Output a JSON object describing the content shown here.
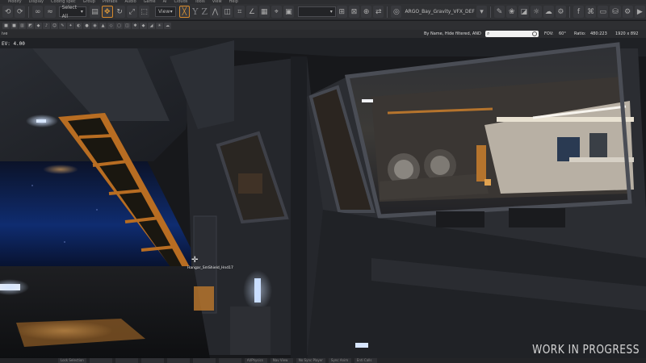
{
  "menu": [
    "Modify",
    "Display",
    "Coding spec",
    "Group",
    "Prefabs",
    "Audio",
    "Game",
    "AI",
    "Clouds",
    "Tools",
    "View",
    "Help"
  ],
  "toolbar": {
    "select_mode": "Select All",
    "view_mode": "View",
    "axis_letters": [
      "Y",
      "Z"
    ],
    "level_name": "ARGO_Bay_Gravity_VFX_DEF"
  },
  "viewport": {
    "label": "ive",
    "filter_text": "By Name, Hide filtered, AND",
    "search_value": "",
    "fov": "FOV:",
    "fov_value": "60°",
    "ratio": "Ratio:",
    "ratio_value": "480:223",
    "resolution": "1920 x 892",
    "ev_readout": "EV:   4.00",
    "entity_label": "Hangar_SmShield_Hnd17",
    "watermark": "WORK IN PROGRESS"
  },
  "bottom_bar": [
    "Lock Selection",
    "",
    "",
    "",
    "",
    "",
    "",
    "AI/Physics",
    "Nav View",
    "No Sync Player",
    "Sync Anim",
    "Enti Calls"
  ],
  "colors": {
    "accent": "#d88a2c",
    "hull_light": "#b8d2ff",
    "interior_glow": "#d6a866"
  }
}
